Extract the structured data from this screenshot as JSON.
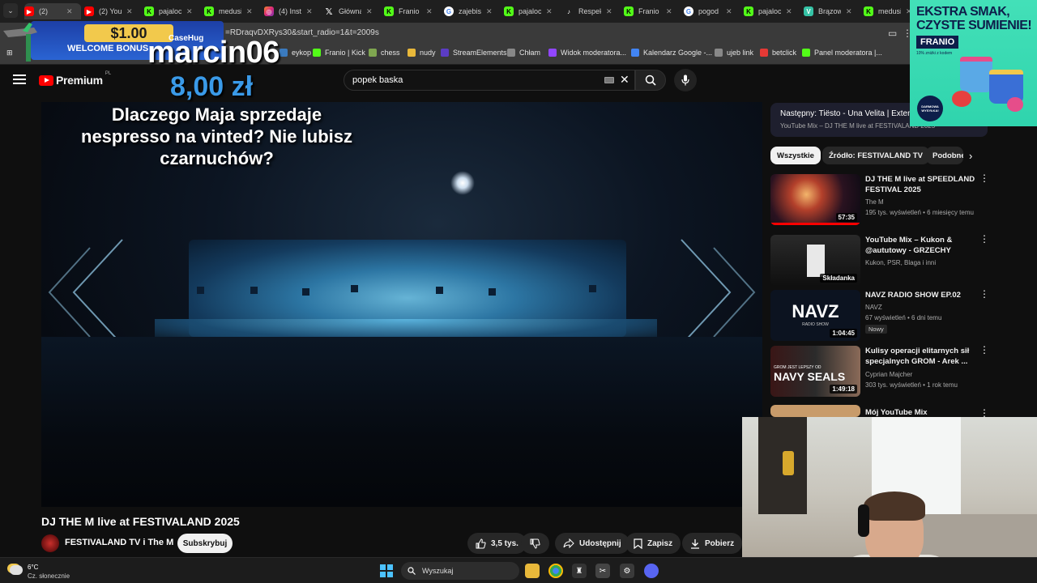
{
  "browser": {
    "tabs": [
      {
        "label": "(2)",
        "icon": "youtube-icon",
        "active": true
      },
      {
        "label": "(2) You",
        "icon": "youtube-icon"
      },
      {
        "label": "pajaloc",
        "icon": "kick-icon"
      },
      {
        "label": "medusi",
        "icon": "kick-icon"
      },
      {
        "label": "(4) Inst",
        "icon": "instagram-icon"
      },
      {
        "label": "Główna",
        "icon": "x-icon"
      },
      {
        "label": "Franio",
        "icon": "kick-icon"
      },
      {
        "label": "zajebis",
        "icon": "google-icon"
      },
      {
        "label": "pajaloc",
        "icon": "kick-icon"
      },
      {
        "label": "Respek",
        "icon": "tiktok-icon"
      },
      {
        "label": "Franio",
        "icon": "kick-icon"
      },
      {
        "label": "pogod",
        "icon": "google-icon"
      },
      {
        "label": "pajaloc",
        "icon": "kick-icon"
      },
      {
        "label": "Brązow",
        "icon": "v-icon"
      },
      {
        "label": "medusi",
        "icon": "kick-icon"
      }
    ],
    "url": "=RDraqvDXRys30&start_radio=1&t=2009s",
    "bookmarks": [
      {
        "label": "eykop",
        "icon": "wykop-icon"
      },
      {
        "label": "Franio | Kick",
        "icon": "kick-icon"
      },
      {
        "label": "chess",
        "icon": "chess-icon"
      },
      {
        "label": "nudy",
        "icon": "folder-icon"
      },
      {
        "label": "StreamElements",
        "icon": "streamelements-icon"
      },
      {
        "label": "Chłam",
        "icon": "globe-icon"
      },
      {
        "label": "Widok moderatora...",
        "icon": "twitch-icon"
      },
      {
        "label": "Kalendarz Google -...",
        "icon": "calendar-icon"
      },
      {
        "label": "ujeb link",
        "icon": "globe-icon"
      },
      {
        "label": "betclick",
        "icon": "betclick-icon"
      },
      {
        "label": "Panel moderatora |...",
        "icon": "kick-icon"
      }
    ]
  },
  "youtube": {
    "logo_text": "Premium",
    "country": "PL",
    "search_value": "popek baska",
    "video_title": "DJ THE M live at FESTIVALAND 2025",
    "channel_name": "FESTIVALAND TV i The M",
    "subscribe_label": "Subskrybuj",
    "actions": {
      "likes": "3,5 tys.",
      "share": "Udostępnij",
      "save": "Zapisz",
      "download": "Pobierz"
    },
    "next_up": {
      "line1": "Następny: Tiësto - Una Velita | Extended",
      "line2": "YouTube Mix – DJ THE M live at FESTIVALAND 2025"
    },
    "chips": [
      "Wszystkie",
      "Źródło: FESTIVALAND TV",
      "Podobne"
    ],
    "recommendations": [
      {
        "title": "DJ THE M live at SPEEDLAND FESTIVAL 2025",
        "channel": "The M",
        "meta": "195 tys. wyświetleń • 6 miesięcy temu",
        "duration": "57:35"
      },
      {
        "title": "YouTube Mix – Kukon & @aututowy - GRZECHY",
        "channel": "Kukon, PSR, Blaga i inni",
        "meta": "",
        "duration": "Składanka"
      },
      {
        "title": "NAVZ RADIO SHOW EP.02",
        "channel": "NAVZ",
        "meta": "67 wyświetleń • 6 dni temu",
        "badge": "Nowy",
        "duration": "1:04:45",
        "thumb_text": "NAVZ",
        "thumb_sub": "RADIO SHOW"
      },
      {
        "title": "Kulisy operacji elitarnych sił specjalnych GROM - Arek ...",
        "channel": "Cyprian Majcher",
        "meta": "303 tys. wyświetleń • 1 rok temu",
        "duration": "1:49:18",
        "thumb_text": "NAVY SEALS",
        "thumb_sub": "GROM JEST LEPSZY OD"
      },
      {
        "title": "Mój YouTube Mix",
        "channel": "",
        "meta": "",
        "duration": ""
      }
    ]
  },
  "overlay": {
    "donor": "marcin06",
    "amount": "8,00 zł",
    "message": "Dlaczego Maja sprzedaje nespresso na vinted? Nie lubisz czarnuchów?",
    "promo_amount": "$1.00",
    "promo_text": "WELCOME BONUS",
    "promo_brand": "CaseHug"
  },
  "ad": {
    "headline_1": "EKSTRA SMAK,",
    "headline_2": "CZYSTE SUMIENIE!",
    "brand": "FRANIO",
    "sub": "10% zniżki z kodem",
    "stamp": "DARMOWA WYSYŁKA!"
  },
  "taskbar": {
    "temp": "6°C",
    "weather": "Cz. słonecznie",
    "search_placeholder": "Wyszukaj"
  },
  "colors": {
    "youtube_red": "#ff0000",
    "kick_green": "#53fc18",
    "donation_amount": "#3a9ae8",
    "ad_bg": "#2fd4ad"
  }
}
